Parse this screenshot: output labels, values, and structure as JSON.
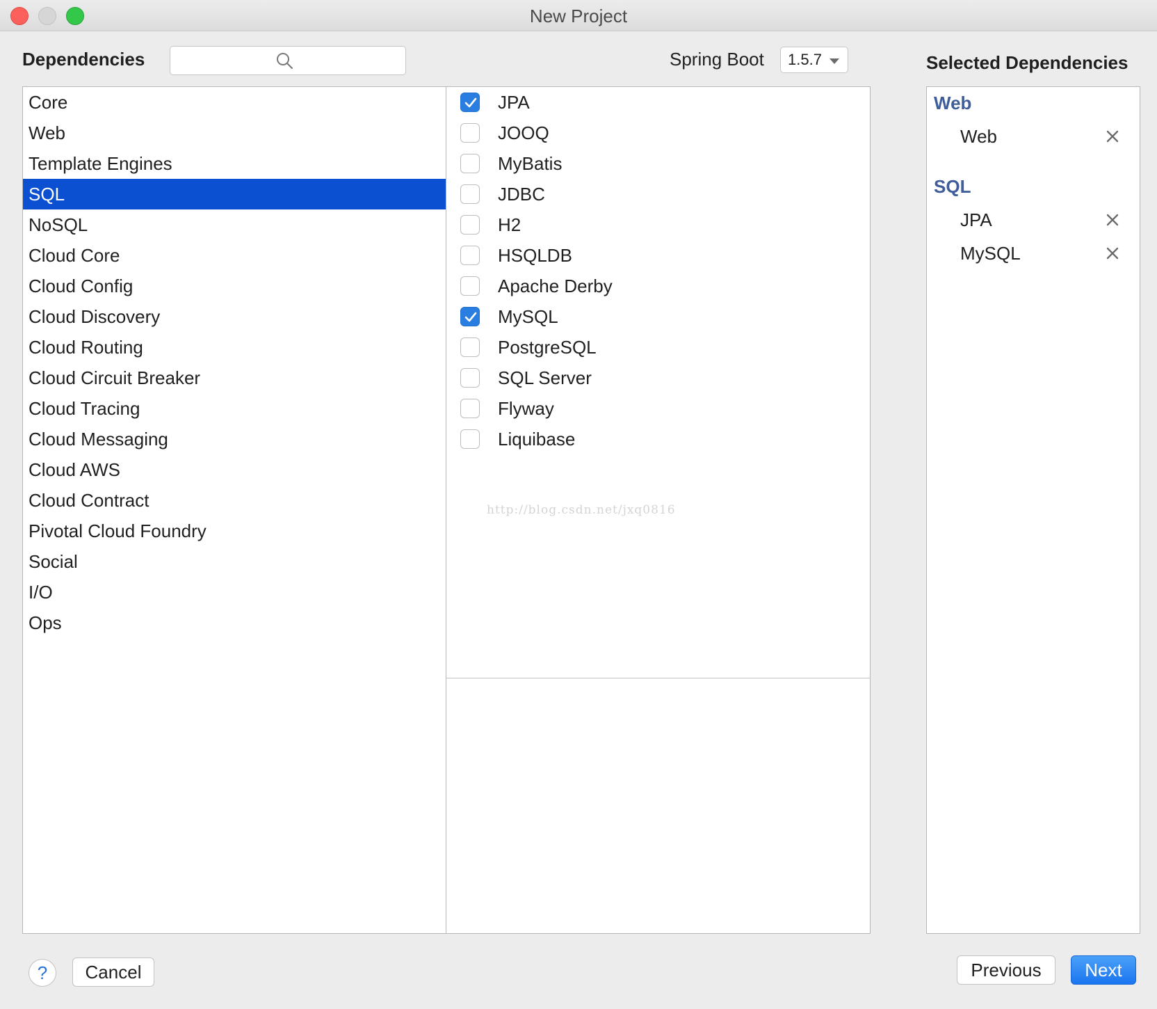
{
  "window": {
    "title": "New Project"
  },
  "header": {
    "dependencies_label": "Dependencies",
    "search": {
      "value": "",
      "placeholder": ""
    },
    "spring_boot_label": "Spring Boot",
    "spring_boot_version": "1.5.7",
    "selected_label": "Selected Dependencies"
  },
  "categories": [
    "Core",
    "Web",
    "Template Engines",
    "SQL",
    "NoSQL",
    "Cloud Core",
    "Cloud Config",
    "Cloud Discovery",
    "Cloud Routing",
    "Cloud Circuit Breaker",
    "Cloud Tracing",
    "Cloud Messaging",
    "Cloud AWS",
    "Cloud Contract",
    "Pivotal Cloud Foundry",
    "Social",
    "I/O",
    "Ops"
  ],
  "selected_category": "SQL",
  "dependencies": [
    {
      "label": "JPA",
      "checked": true
    },
    {
      "label": "JOOQ",
      "checked": false
    },
    {
      "label": "MyBatis",
      "checked": false
    },
    {
      "label": "JDBC",
      "checked": false
    },
    {
      "label": "H2",
      "checked": false
    },
    {
      "label": "HSQLDB",
      "checked": false
    },
    {
      "label": "Apache Derby",
      "checked": false
    },
    {
      "label": "MySQL",
      "checked": true
    },
    {
      "label": "PostgreSQL",
      "checked": false
    },
    {
      "label": "SQL Server",
      "checked": false
    },
    {
      "label": "Flyway",
      "checked": false
    },
    {
      "label": "Liquibase",
      "checked": false
    }
  ],
  "watermark": "http://blog.csdn.net/jxq0816",
  "selected": {
    "groups": [
      {
        "name": "Web",
        "items": [
          "Web"
        ]
      },
      {
        "name": "SQL",
        "items": [
          "JPA",
          "MySQL"
        ]
      }
    ]
  },
  "footer": {
    "help_label": "?",
    "cancel_label": "Cancel",
    "previous_label": "Previous",
    "next_label": "Next"
  },
  "colors": {
    "selection": "#0c50d2",
    "checkbox_checked": "#2a7de1",
    "group_header": "#3f5d9a",
    "next_button": "#1a75f0"
  }
}
